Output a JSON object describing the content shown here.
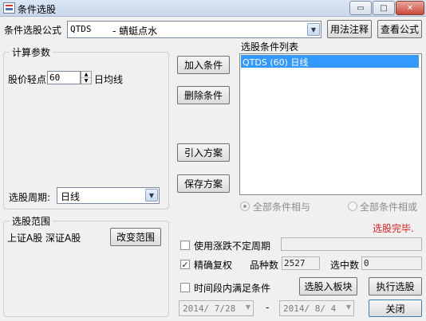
{
  "window": {
    "title": "条件选股",
    "controls": {
      "minimize": "▭",
      "restore": "□",
      "close": "✕"
    }
  },
  "formula": {
    "label": "条件选股公式",
    "code": "QTDS",
    "name": "- 蜻蜓点水",
    "usage_button": "用法注释",
    "view_button": "查看公式"
  },
  "params": {
    "group_title": "计算参数",
    "label": "股价轻点",
    "value": "60",
    "suffix": "日均线"
  },
  "period": {
    "label": "选股周期:",
    "value": "日线"
  },
  "actions": {
    "add": "加入条件",
    "delete": "删除条件",
    "import": "引入方案",
    "save": "保存方案"
  },
  "condition_list": {
    "title": "选股条件列表",
    "items": [
      "QTDS (60) 日线"
    ]
  },
  "logic": {
    "and": "全部条件相与",
    "or": "全部条件相或"
  },
  "status": {
    "text": "选股完毕.",
    "color": "#e02020"
  },
  "range": {
    "group_title": "选股范围",
    "value": "上证A股 深证A股",
    "change_button": "改变范围"
  },
  "options": {
    "irregular_period": "使用涨跌不定周期",
    "exact_restore": "精确复权",
    "exact_restore_checked": true,
    "variety_label": "品种数",
    "variety_value": "2527",
    "selected_label": "选中数",
    "selected_value": "0",
    "time_range": "时间段内满足条件"
  },
  "dates": {
    "start": "2014/ 7/28",
    "separator": "-",
    "end": "2014/ 8/ 4"
  },
  "buttons": {
    "to_sector": "选股入板块",
    "execute": "执行选股",
    "close": "关闭"
  }
}
